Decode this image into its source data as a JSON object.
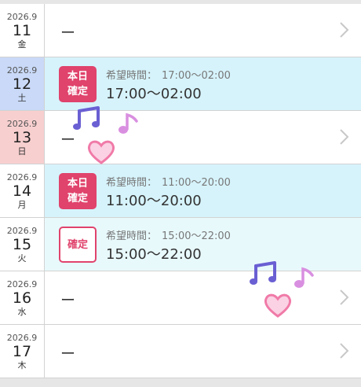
{
  "rows": [
    {
      "ym": "2026.9",
      "day": "11",
      "dow": "金",
      "dash": "ー"
    },
    {
      "ym": "2026.9",
      "day": "12",
      "dow": "土",
      "badge": [
        "本日",
        "確定"
      ],
      "req_label": "希望時間：",
      "req_time": "17:00〜02:00",
      "time": "17:00〜02:00"
    },
    {
      "ym": "2026.9",
      "day": "13",
      "dow": "日",
      "dash": "ー"
    },
    {
      "ym": "2026.9",
      "day": "14",
      "dow": "月",
      "badge": [
        "本日",
        "確定"
      ],
      "req_label": "希望時間：",
      "req_time": "11:00〜20:00",
      "time": "11:00〜20:00"
    },
    {
      "ym": "2026.9",
      "day": "15",
      "dow": "火",
      "badge_outline": "確定",
      "req_label": "希望時間：",
      "req_time": "15:00〜22:00",
      "time": "15:00〜22:00"
    },
    {
      "ym": "2026.9",
      "day": "16",
      "dow": "水",
      "dash": "ー"
    },
    {
      "ym": "2026.9",
      "day": "17",
      "dow": "木",
      "dash": "ー"
    }
  ],
  "colors": {
    "badge": "#e0436c",
    "row_highlight": "#d6f3fb",
    "saturday": "#c9d9f7",
    "sunday": "#f8cfcf"
  },
  "decorations": [
    "music-note-icon",
    "heart-icon"
  ]
}
